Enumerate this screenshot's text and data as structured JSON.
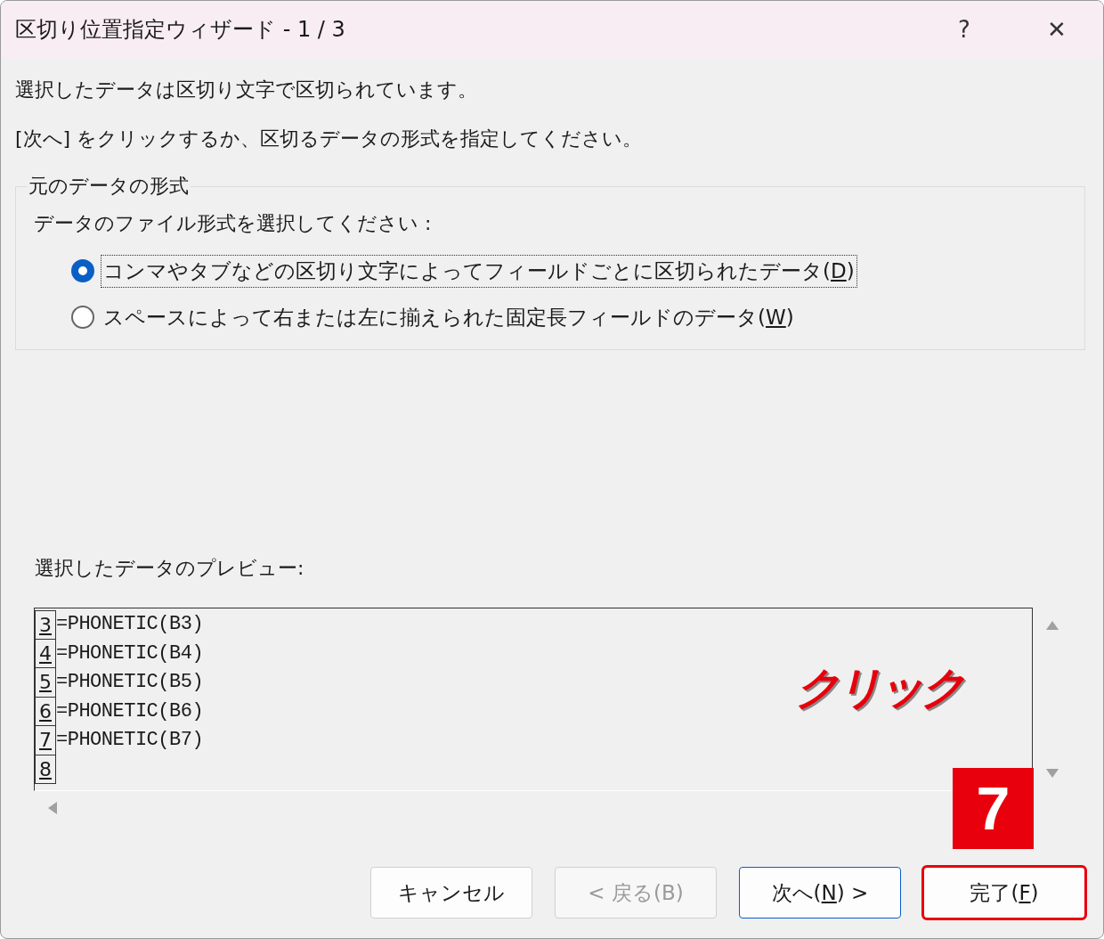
{
  "window": {
    "title": "区切り位置指定ウィザード - 1 / 3",
    "help": "?",
    "close": "✕"
  },
  "intro": [
    "選択したデータは区切り文字で区切られています。",
    "[次へ] をクリックするか、区切るデータの形式を指定してください。"
  ],
  "group": {
    "title": "元のデータの形式",
    "prompt": "データのファイル形式を選択してください :",
    "options": [
      {
        "text": "コンマやタブなどの区切り文字によってフィールドごとに区切られたデータ(",
        "key": "D",
        "end": ")",
        "selected": true
      },
      {
        "text": "スペースによって右または左に揃えられた固定長フィールドのデータ(",
        "key": "W",
        "end": ")",
        "selected": false
      }
    ]
  },
  "preview": {
    "label": "選択したデータのプレビュー:",
    "rows": [
      {
        "num": "3",
        "text": "=PHONETIC(B3)"
      },
      {
        "num": "4",
        "text": "=PHONETIC(B4)"
      },
      {
        "num": "5",
        "text": "=PHONETIC(B5)"
      },
      {
        "num": "6",
        "text": "=PHONETIC(B6)"
      },
      {
        "num": "7",
        "text": "=PHONETIC(B7)"
      },
      {
        "num": "8"
      }
    ]
  },
  "buttons": [
    {
      "text": "キャンセル",
      "disabled": false,
      "default": false,
      "highlighted": false
    },
    {
      "text": "< 戻る(B)",
      "disabled": true,
      "default": false,
      "highlighted": false
    },
    {
      "text": "次へ(",
      "key": "N",
      "end": ") >",
      "disabled": false,
      "default": true,
      "highlighted": false
    },
    {
      "text": "完了(",
      "key": "F",
      "end": ")",
      "disabled": false,
      "default": false,
      "highlighted": true
    }
  ],
  "annotation": {
    "text": "クリック",
    "step": "7"
  }
}
